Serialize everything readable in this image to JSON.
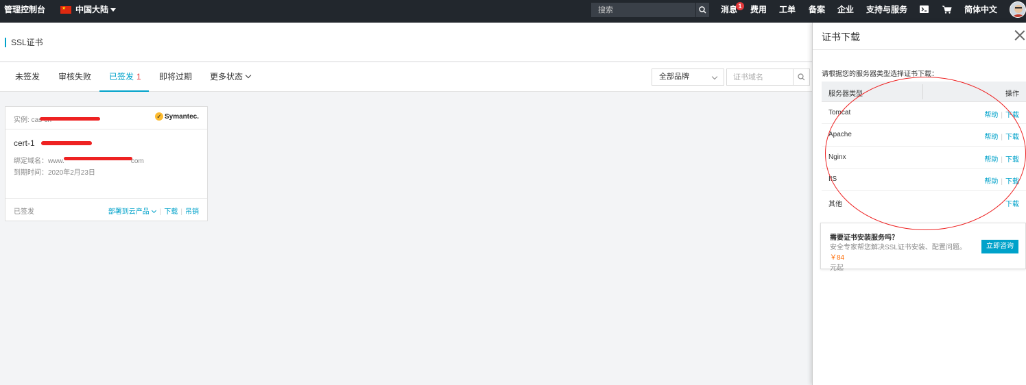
{
  "topbar": {
    "brand": "管理控制台",
    "region": "中国大陆",
    "search_placeholder": "搜索",
    "nav": {
      "messages": "消息",
      "messages_badge": "1",
      "billing": "费用",
      "tickets": "工单",
      "icp": "备案",
      "enterprise": "企业",
      "support": "支持与服务",
      "language": "简体中文"
    }
  },
  "page": {
    "title": "SSL证书"
  },
  "tabs": [
    {
      "label": "未签发"
    },
    {
      "label": "审核失败"
    },
    {
      "label": "已签发",
      "count": "1"
    },
    {
      "label": "即将过期"
    },
    {
      "label": "更多状态"
    }
  ],
  "filters": {
    "brand_select": "全部品牌",
    "domain_placeholder": "证书域名"
  },
  "card": {
    "instance_label": "实例: ",
    "instance_value": "cas-cn-",
    "brand_logo": "Symantec.",
    "cert_name": "cert-1",
    "bind_domain_label": "绑定域名：",
    "bind_domain_prefix": "www.",
    "bind_domain_suffix": "com",
    "expire_label": "到期时间：",
    "expire_value": "2020年2月23日",
    "status": "已签发",
    "actions": {
      "deploy": "部署到云产品",
      "download": "下载",
      "revoke": "吊销"
    }
  },
  "drawer": {
    "title": "证书下载",
    "hint": "请根据您的服务器类型选择证书下载：",
    "table": {
      "col_server": "服务器类型",
      "col_action": "操作",
      "rows": [
        {
          "name": "Tomcat",
          "help": "帮助",
          "download": "下载"
        },
        {
          "name": "Apache",
          "help": "帮助",
          "download": "下载"
        },
        {
          "name": "Nginx",
          "help": "帮助",
          "download": "下载"
        },
        {
          "name": "IIS",
          "help": "帮助",
          "download": "下载"
        },
        {
          "name": "其他",
          "download": "下载"
        }
      ]
    },
    "service": {
      "title": "需要证书安装服务吗？",
      "desc": "安全专家帮您解决SSL证书安装、配置问题。",
      "price": "￥84",
      "unit": "元起",
      "button": "立即咨询"
    }
  },
  "colors": {
    "accent": "#00a2ca",
    "topbar_bg": "#22272d",
    "badge": "#e4393c",
    "annotation": "#e22222",
    "price": "#ff6a00"
  }
}
